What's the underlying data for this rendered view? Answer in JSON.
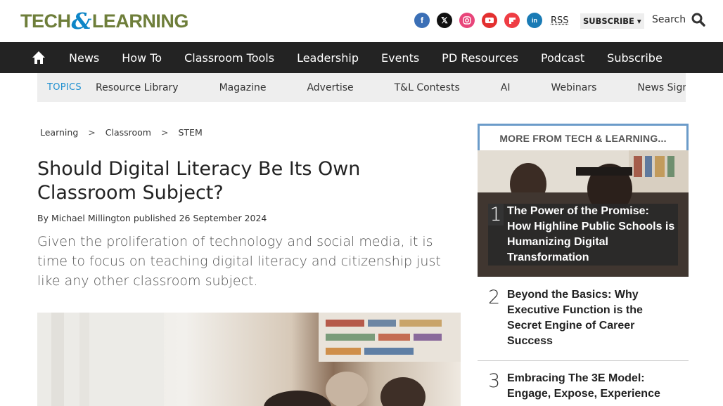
{
  "header": {
    "logo_text_left": "TECH",
    "logo_amp": "&",
    "logo_text_right": "LEARNING",
    "rss_label": "RSS",
    "subscribe_label": "SUBSCRIBE ▾",
    "search_label": "Search",
    "social": [
      "facebook-icon",
      "x-twitter-icon",
      "instagram-icon",
      "youtube-icon",
      "flipboard-icon",
      "linkedin-icon"
    ]
  },
  "nav": {
    "items": [
      "News",
      "How To",
      "Classroom Tools",
      "Leadership",
      "Events",
      "PD Resources",
      "Podcast",
      "Subscribe"
    ]
  },
  "subnav": {
    "topics_label": "TOPICS",
    "items": [
      "Resource Library",
      "Magazine",
      "Advertise",
      "T&L Contests",
      "AI",
      "Webinars",
      "News Sign"
    ]
  },
  "article": {
    "breadcrumb": [
      "Learning",
      "Classroom",
      "STEM"
    ],
    "title": "Should Digital Literacy Be Its Own Classroom Subject?",
    "byline_prefix": "By",
    "author": "Michael Millington",
    "published_prefix": "published",
    "date": "26 September 2024",
    "lede": "Given the proliferation of technology and social media, it is time to focus on teaching digital literacy and citizenship just like any other classroom subject."
  },
  "sidebar": {
    "heading": "MORE FROM TECH & LEARNING...",
    "items": [
      {
        "num": "1",
        "text": "The Power of the Promise: How Highline Public Schools is Humanizing Digital Transformation"
      },
      {
        "num": "2",
        "text": "Beyond the Basics: Why Executive Function is the Secret Engine of Career Success"
      },
      {
        "num": "3",
        "text": "Embracing The 3E Model: Engage, Expose, Experience"
      }
    ]
  },
  "colors": {
    "nav_bg": "#232323",
    "accent_blue": "#1d8fd0",
    "logo_green": "#6e7e3a",
    "sidebar_border": "#6b9bc9"
  }
}
